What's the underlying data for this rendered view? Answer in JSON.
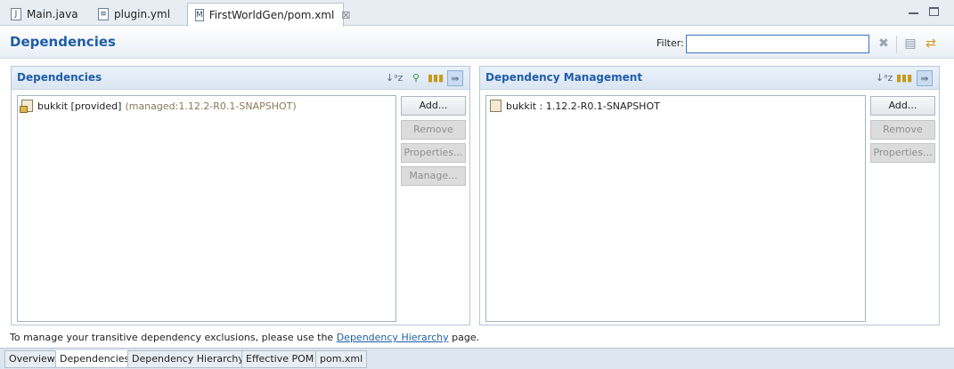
{
  "editor_tabs": [
    {
      "label": "Main.java",
      "icon": "java-file-icon",
      "active": false
    },
    {
      "label": "plugin.yml",
      "icon": "yml-file-icon",
      "active": false
    },
    {
      "label": "FirstWorldGen/pom.xml",
      "icon": "maven-file-icon",
      "active": true,
      "close": "☒"
    }
  ],
  "header": {
    "title": "Dependencies",
    "filter_label": "Filter:",
    "filter_value": ""
  },
  "dependencies": {
    "title": "Dependencies",
    "items": [
      {
        "name": "bukkit [provided]",
        "managed": "(managed:1.12.2-R0.1-SNAPSHOT)"
      }
    ],
    "buttons": {
      "add": "Add...",
      "remove": "Remove",
      "properties": "Properties...",
      "manage": "Manage..."
    }
  },
  "dependency_management": {
    "title": "Dependency Management",
    "items": [
      {
        "name": "bukkit : 1.12.2-R0.1-SNAPSHOT"
      }
    ],
    "buttons": {
      "add": "Add...",
      "remove": "Remove",
      "properties": "Properties..."
    }
  },
  "hint": {
    "prefix": "To manage your transitive dependency exclusions, please use the",
    "link": "Dependency Hierarchy",
    "suffix": "page."
  },
  "page_tabs": [
    {
      "label": "Overview",
      "active": false
    },
    {
      "label": "Dependencies",
      "active": true
    },
    {
      "label": "Dependency Hierarchy",
      "active": false
    },
    {
      "label": "Effective POM",
      "active": false
    },
    {
      "label": "pom.xml",
      "active": false
    }
  ],
  "colors": {
    "accent": "#1f5ea8",
    "managed_text": "#8a7a58"
  }
}
